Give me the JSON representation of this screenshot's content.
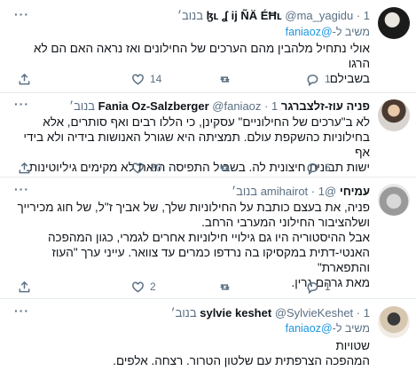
{
  "tweets": [
    {
      "name": "ɮʟ ʆ ĳ ÑÄ ÉĦʟ",
      "handle": "@ma_yagidu",
      "sep": "·",
      "time": "1 בנוב׳",
      "reply_prefix": "משיב ל-",
      "reply_to": "@faniaoz",
      "text": "אולי נתחיל מלהבין מהם הערכים של החילונים ואז נראה האם הם לא הרגו\nבשבילם.",
      "likes": "14",
      "retweets": "",
      "replies": "1"
    },
    {
      "name": "פניה עוז-זלצברגר Fania Oz-Salzberger",
      "handle": "@faniaoz",
      "sep": "·",
      "time": "1 בנוב׳",
      "text": "לא ב\"ערכים של החילוניים\" עסקינן, כי הללו רבים ואף סותרים, אלא\nבחילוניות כהשקפת עולם. תמציתה היא שגורל האנושות בידיה ולא בידי אף\nישות תבונית חיצונית לה. בשביל התפיסה הזאת לא מקימים גיליוטינות.",
      "likes": "20",
      "retweets": "",
      "replies": "6"
    },
    {
      "name": "עמיחי",
      "handle": "@amihairot",
      "sep": "·",
      "time": "1 בנוב׳",
      "text": "פניה, את בעצם כותבת על החילוניות שלך, של אביך ז\"ל, של חוג מכירייך\nושלהציבור החילוני המערבי הרחב.\nאבל ההיסטוריה היו גם גילויי חילוניות אחרים לגמרי, כגון המהפכה\nהאנטי-דתית במקסיקו בה נרדפו כמרים עד צוואר. עייני ערך \"העוז והתפארת\"\nמאת גרהם גרין.",
      "likes": "2",
      "retweets": "",
      "replies": "1"
    },
    {
      "name": "sylvie keshet",
      "handle": "@SylvieKeshet",
      "sep": "·",
      "time": "1 בנוב׳",
      "reply_prefix": "משיב ל-",
      "reply_to": "@faniaoz",
      "text": "שטויות\nהמהפכה הצרפתית עם שלטון הטרור. רצחה. אלפים."
    }
  ],
  "more_icon": "more-dots-icon",
  "colors": {
    "link": "#1b95e0",
    "muted": "#5b7083",
    "divider": "#e6ecf0"
  }
}
